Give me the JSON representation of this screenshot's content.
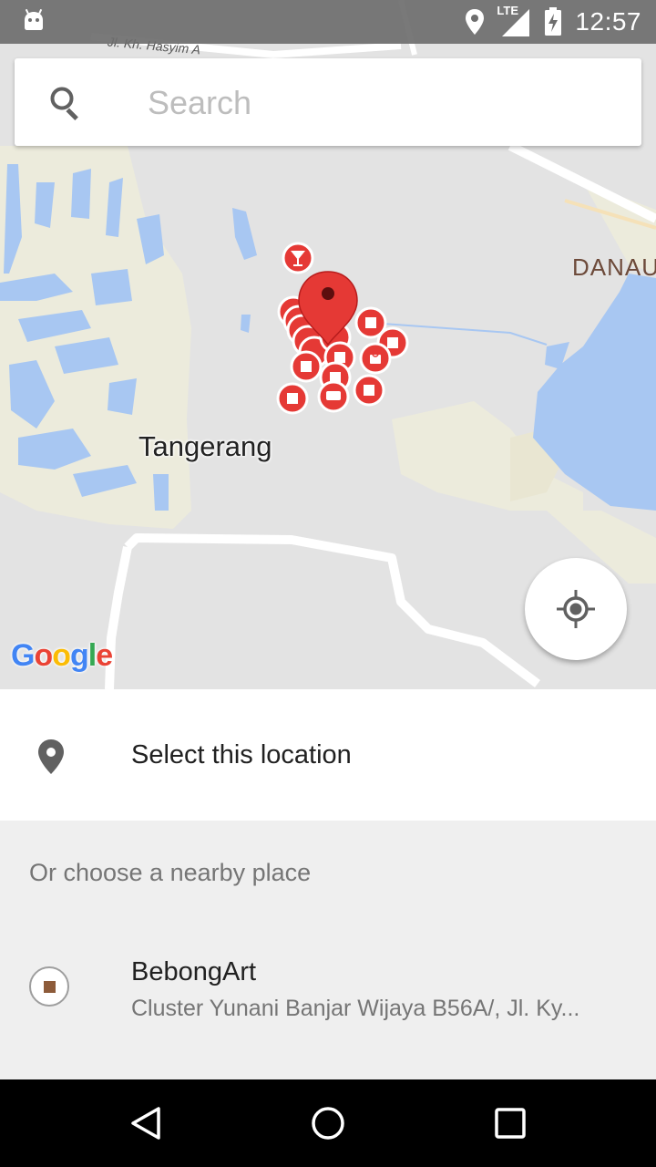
{
  "status_bar": {
    "clock": "12:57",
    "network_label": "LTE",
    "icons": [
      "android-icon",
      "location-icon",
      "signal-icon",
      "battery-charging-icon"
    ]
  },
  "search": {
    "placeholder": "Search",
    "value": ""
  },
  "map": {
    "labels": {
      "city": "Tangerang",
      "lake": "DANAU",
      "road": "Jl. Kh. Hasyim A"
    },
    "attribution": [
      "G",
      "o",
      "o",
      "g",
      "l",
      "e"
    ],
    "attribution_colors": [
      "#4285f4",
      "#ea4335",
      "#fbbc05",
      "#4285f4",
      "#34a853",
      "#ea4335"
    ],
    "marker_color": "#e53935"
  },
  "select_location": {
    "label": "Select this location"
  },
  "nearby": {
    "header": "Or choose a nearby place",
    "places": [
      {
        "name": "BebongArt",
        "address": "Cluster Yunani Banjar Wijaya B56A/, Jl. Ky..."
      }
    ]
  },
  "nav_bar": {
    "icons": [
      "back-icon",
      "home-icon",
      "recents-icon"
    ]
  }
}
